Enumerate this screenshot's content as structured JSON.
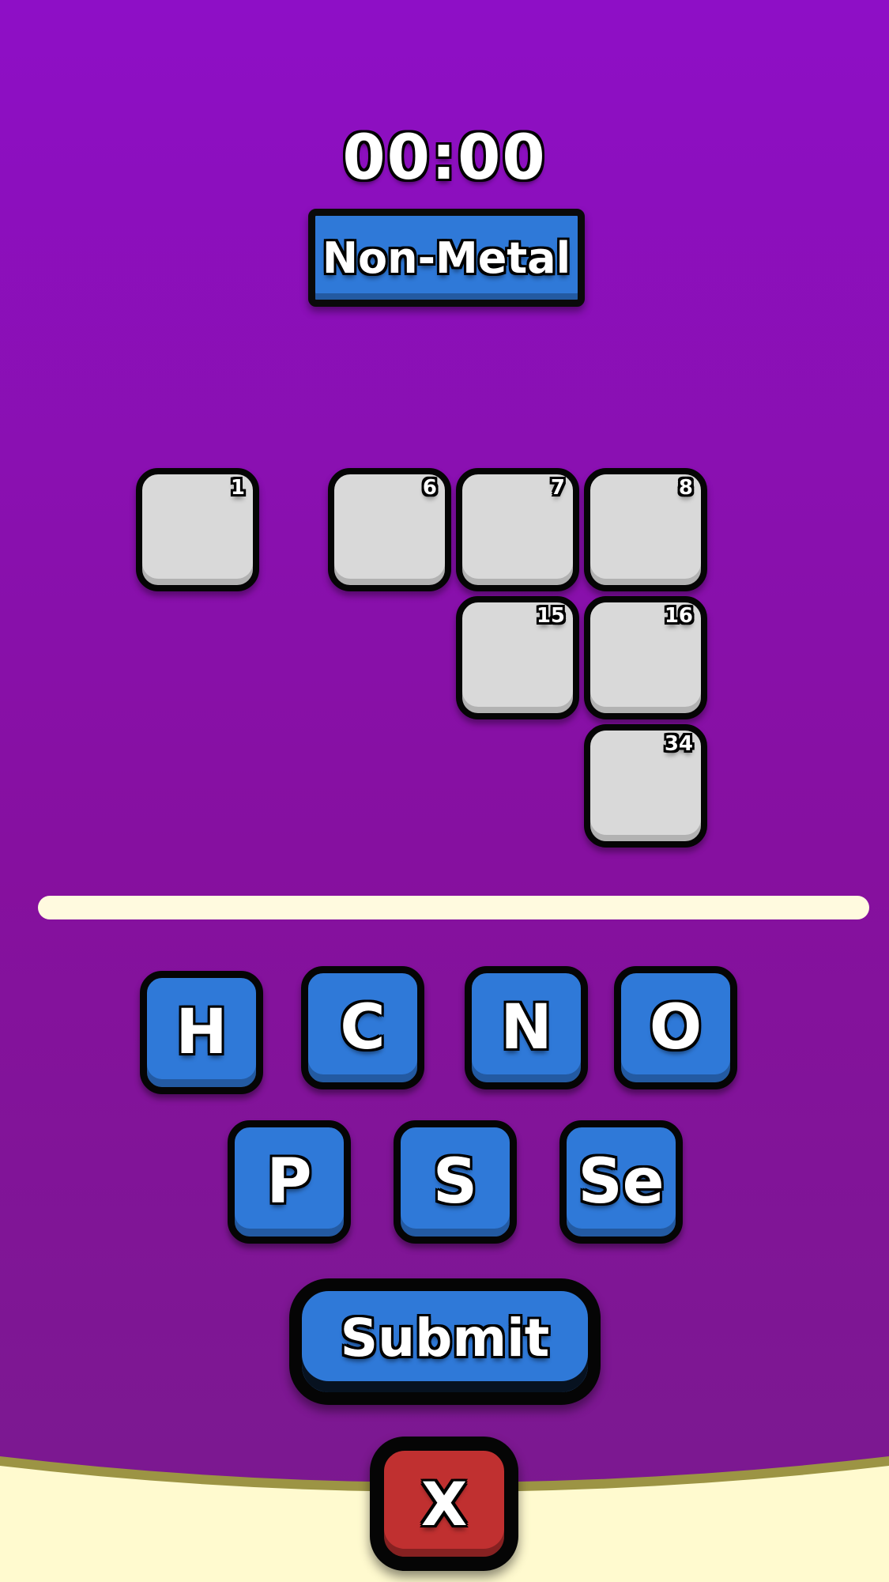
{
  "timer": "00:00",
  "category": "Non-Metal",
  "slots": [
    {
      "number": "1"
    },
    {
      "number": "6"
    },
    {
      "number": "7"
    },
    {
      "number": "8"
    },
    {
      "number": "15"
    },
    {
      "number": "16"
    },
    {
      "number": "34"
    }
  ],
  "tiles": [
    {
      "symbol": "H"
    },
    {
      "symbol": "C"
    },
    {
      "symbol": "N"
    },
    {
      "symbol": "O"
    },
    {
      "symbol": "P"
    },
    {
      "symbol": "S"
    },
    {
      "symbol": "Se"
    }
  ],
  "submit_label": "Submit",
  "close_label": "X",
  "colors": {
    "background": "#8e0fc6",
    "tile_blue": "#2f79d8",
    "slot_gray": "#d9d9d9",
    "close_red": "#c03030",
    "cream": "#fffadf"
  }
}
